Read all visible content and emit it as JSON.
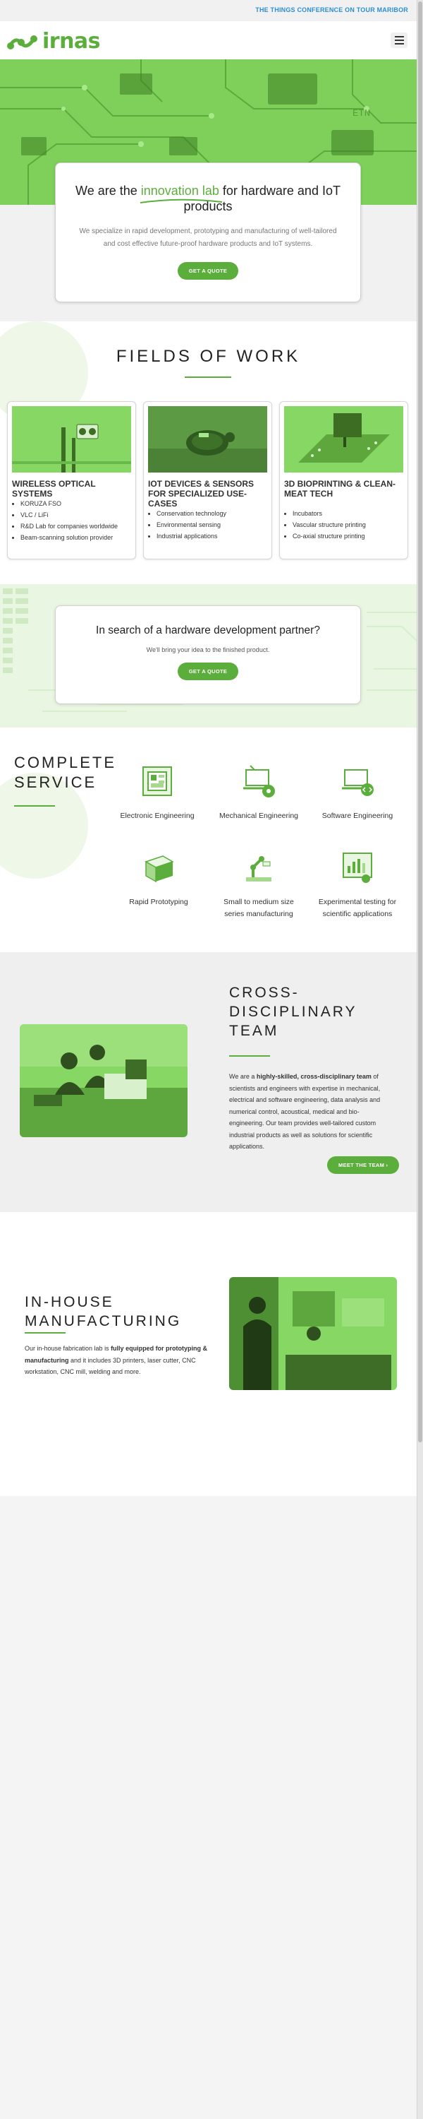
{
  "topbar": {
    "link": "THE THINGS CONFERENCE ON TOUR MARIBOR"
  },
  "header": {
    "logo_text": "irnas",
    "menu_icon": "hamburger-icon"
  },
  "hero": {
    "title_pre": "We are the",
    "title_highlight": "innovation lab",
    "title_post": "for hardware and IoT products",
    "text": "We specialize in rapid development, prototyping and manufacturing of well-tailored and cost effective future-proof hardware products and IoT systems.",
    "button": "GET A QUOTE"
  },
  "fields": {
    "title": "FIELDS OF WORK",
    "cards": [
      {
        "title": "WIRELESS OPTICAL SYSTEMS",
        "items": [
          "KORUZA FSO",
          "VLC / LiFi",
          "R&D Lab for companies worldwide",
          "Beam-scanning solution provider"
        ]
      },
      {
        "title": "IOT DEVICES & SENSORS FOR SPECIALIZED USE-CASES",
        "items": [
          "Conservation technology",
          "Environmental sensing",
          "Industrial applications"
        ]
      },
      {
        "title": "3D BIOPRINTING & CLEAN-MEAT TECH",
        "items": [
          "Incubators",
          "Vascular structure printing",
          "Co-axial structure printing"
        ]
      }
    ]
  },
  "partner": {
    "title": "In search of a hardware development partner?",
    "text": "We'll bring your idea to the finished product.",
    "button": "GET A QUOTE"
  },
  "service": {
    "title_line1": "COMPLETE",
    "title_line2": "SERVICE",
    "items": [
      {
        "label": "Electronic Engineering",
        "icon": "circuit-board-icon"
      },
      {
        "label": "Mechanical Engineering",
        "icon": "laptop-gear-icon"
      },
      {
        "label": "Software Engineering",
        "icon": "laptop-code-icon"
      },
      {
        "label": "Rapid Prototyping",
        "icon": "3d-box-icon"
      },
      {
        "label": "Small to medium size series manufacturing",
        "icon": "robot-arm-icon"
      },
      {
        "label": "Experimental testing for scientific applications",
        "icon": "certificate-chart-icon"
      }
    ]
  },
  "team": {
    "title_line1": "CROSS-",
    "title_line2": "DISCIPLINARY",
    "title_line3": "TEAM",
    "text_pre": "We are a ",
    "text_bold": "highly-skilled, cross-disciplinary team",
    "text_post": " of scientists and engineers with expertise in mechanical, electrical and software engineering, data analysis and numerical control, acoustical, medical and bio-engineering. Our team provides well-tailored custom industrial products as well as solutions for scientific applications.",
    "button": "MEET THE TEAM",
    "button_icon": "chevron-right-icon"
  },
  "manufacturing": {
    "title_line1": "IN-HOUSE",
    "title_line2": "MANUFACTURING",
    "text_pre": "Our in-house fabrication lab is ",
    "text_bold": "fully equipped for prototyping & manufacturing",
    "text_post": " and it includes 3D printers, laser cutter, CNC workstation, CNC mill, welding and more."
  },
  "colors": {
    "brand_green": "#5cae3c",
    "light_green": "#e9f6e2",
    "link_blue": "#2a8ed4"
  }
}
